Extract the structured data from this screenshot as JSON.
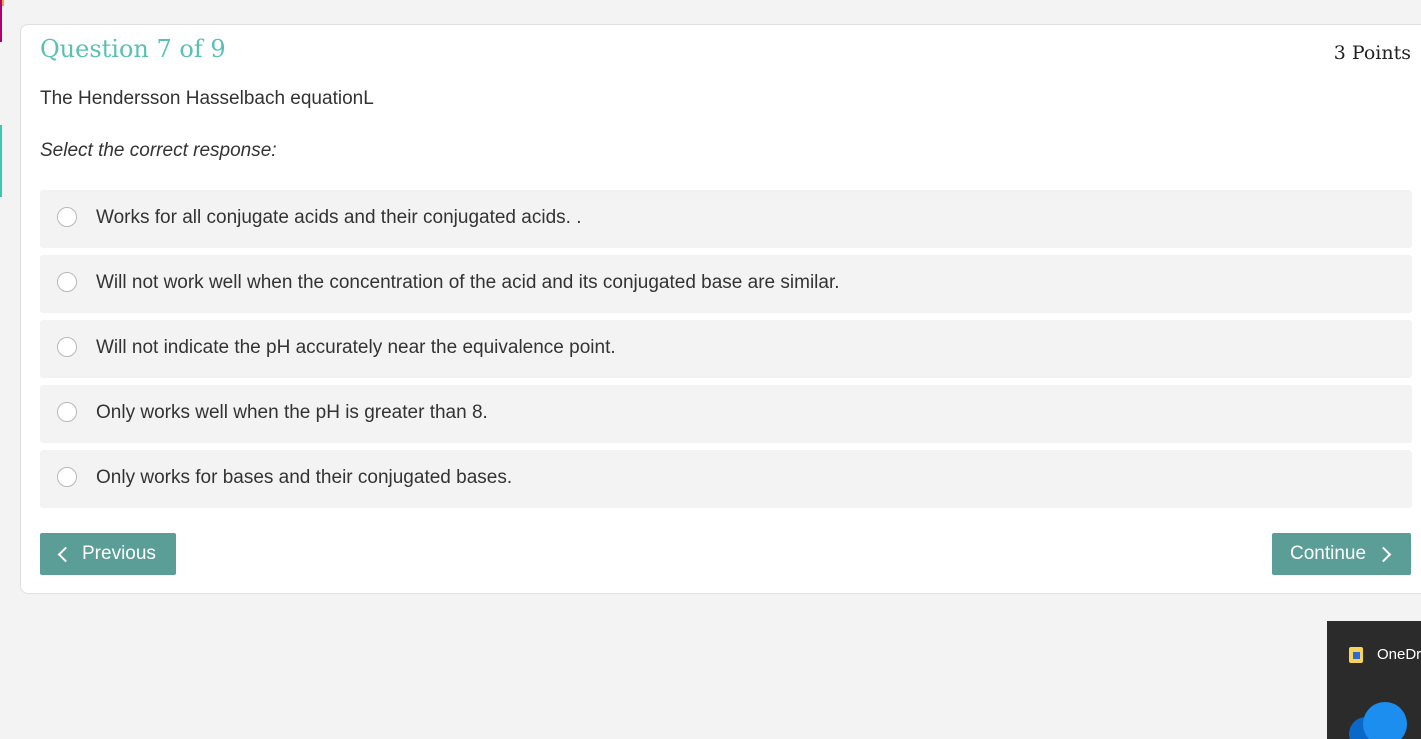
{
  "question": {
    "title": "Question 7 of 9",
    "points": "3 Points",
    "prompt": "The Hendersson Hasselbach equationL",
    "instruction": "Select the correct response:",
    "options": [
      {
        "label": "Works for all conjugate acids and their conjugated acids. ."
      },
      {
        "label": "Will not work well when the concentration of the acid and its conjugated base are similar."
      },
      {
        "label": "Will not indicate the pH accurately near the equivalence point."
      },
      {
        "label": "Only works well when the pH is greater than 8."
      },
      {
        "label": "Only works for bases and their conjugated bases."
      }
    ]
  },
  "nav": {
    "previous_label": "Previous",
    "continue_label": "Continue"
  },
  "tray_popup": {
    "title": "OneDr",
    "app_icon": "folder-sync-icon",
    "cloud_icon": "onedrive-cloud-icon"
  },
  "colors": {
    "accent_teal": "#5bc0b4",
    "button_bg": "#5a9e97",
    "option_bg": "#f3f3f3"
  }
}
